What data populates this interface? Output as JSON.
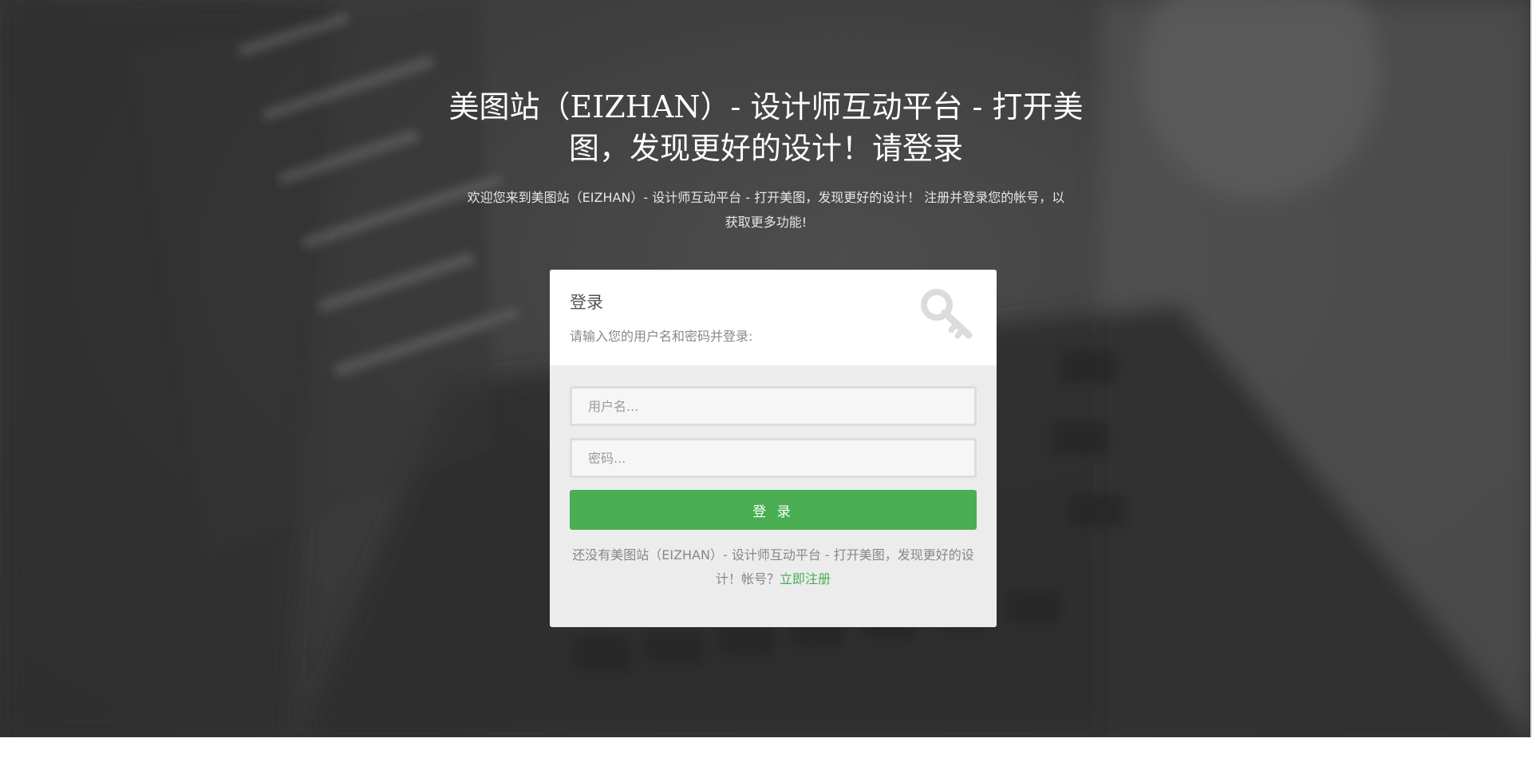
{
  "hero": {
    "headline": "美图站（EIZHAN）- 设计师互动平台 - 打开美图，发现更好的设计！请登录",
    "subline": "欢迎您来到美图站（EIZHAN）- 设计师互动平台 - 打开美图，发现更好的设计！ 注册并登录您的帐号，以获取更多功能!"
  },
  "login": {
    "title": "登录",
    "description": "请输入您的用户名和密码并登录:",
    "icon": "key-icon",
    "username_placeholder": "用户名...",
    "password_placeholder": "密码...",
    "submit_label": "登 录",
    "footer_text": "还没有美图站（EIZHAN）- 设计师互动平台 - 打开美图，发现更好的设计！帐号？",
    "register_link": "立即注册"
  },
  "colors": {
    "accent": "#4aae53",
    "card_header": "#ffffff",
    "card_body": "#ececec",
    "background": "#444444"
  }
}
